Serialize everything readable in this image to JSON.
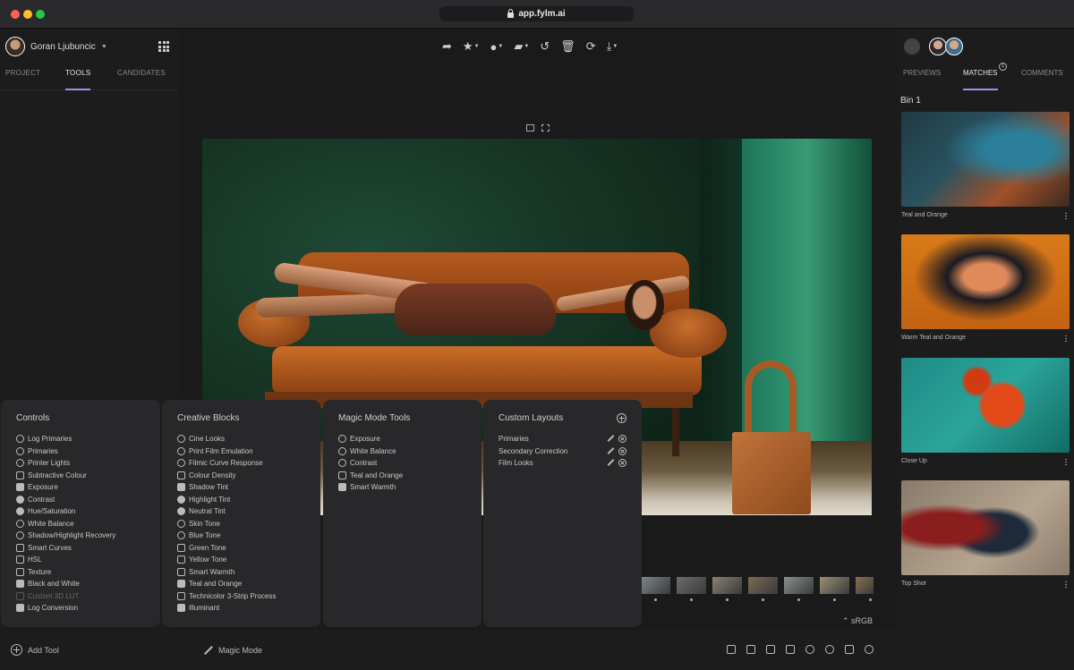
{
  "browser": {
    "url": "app.fylm.ai"
  },
  "left_panel": {
    "user_name": "Goran Ljubuncic",
    "tabs": [
      "PROJECT",
      "TOOLS",
      "CANDIDATES"
    ],
    "active_tab": "TOOLS",
    "add_tool_label": "Add Tool"
  },
  "panels": {
    "controls": {
      "title": "Controls",
      "items": [
        "Log Primaries",
        "Primaries",
        "Printer Lights",
        "Subtractive Colour",
        "Exposure",
        "Contrast",
        "Hue/Saturation",
        "White Balance",
        "Shadow/Highlight Recovery",
        "Smart Curves",
        "HSL",
        "Texture",
        "Black and White",
        "Custom 3D LUT",
        "Log Conversion"
      ]
    },
    "creative": {
      "title": "Creative Blocks",
      "items": [
        "Cine Looks",
        "Print Film Emulation",
        "Filmic Curve Response",
        "Colour Density",
        "Shadow Tint",
        "Highlight Tint",
        "Neutral Tint",
        "Skin Tone",
        "Blue Tone",
        "Green Tone",
        "Yellow Tone",
        "Smart Warmth",
        "Teal and Orange",
        "Technicolor 3-Strip Process",
        "Illuminant"
      ]
    },
    "magic": {
      "title": "Magic Mode Tools",
      "items": [
        "Exposure",
        "White Balance",
        "Contrast",
        "Teal and Orange",
        "Smart Warmth"
      ]
    },
    "custom": {
      "title": "Custom Layouts",
      "items": [
        "Primaries",
        "Secondary Correction",
        "Film Looks"
      ]
    }
  },
  "center": {
    "color_space": "sRGB",
    "magic_mode_label": "Magic Mode",
    "filmstrip_colors": [
      "#7a8a8c",
      "#6a6e6a",
      "#8a8070",
      "#7a6a55",
      "#8a9090",
      "#9a9070",
      "#8a7050"
    ]
  },
  "right_panel": {
    "tabs": [
      "PREVIEWS",
      "MATCHES",
      "COMMENTS"
    ],
    "active_tab": "MATCHES",
    "matches_badge": "1",
    "bin_title": "Bin 1",
    "matches": [
      {
        "caption": "Teal and Orange"
      },
      {
        "caption": "Warm Teal and Orange"
      },
      {
        "caption": "Close Up"
      },
      {
        "caption": "Top Shot"
      }
    ]
  },
  "colors": {
    "accent": "#a98bf0",
    "background": "#1a1a1b",
    "panel": "#28282a"
  }
}
